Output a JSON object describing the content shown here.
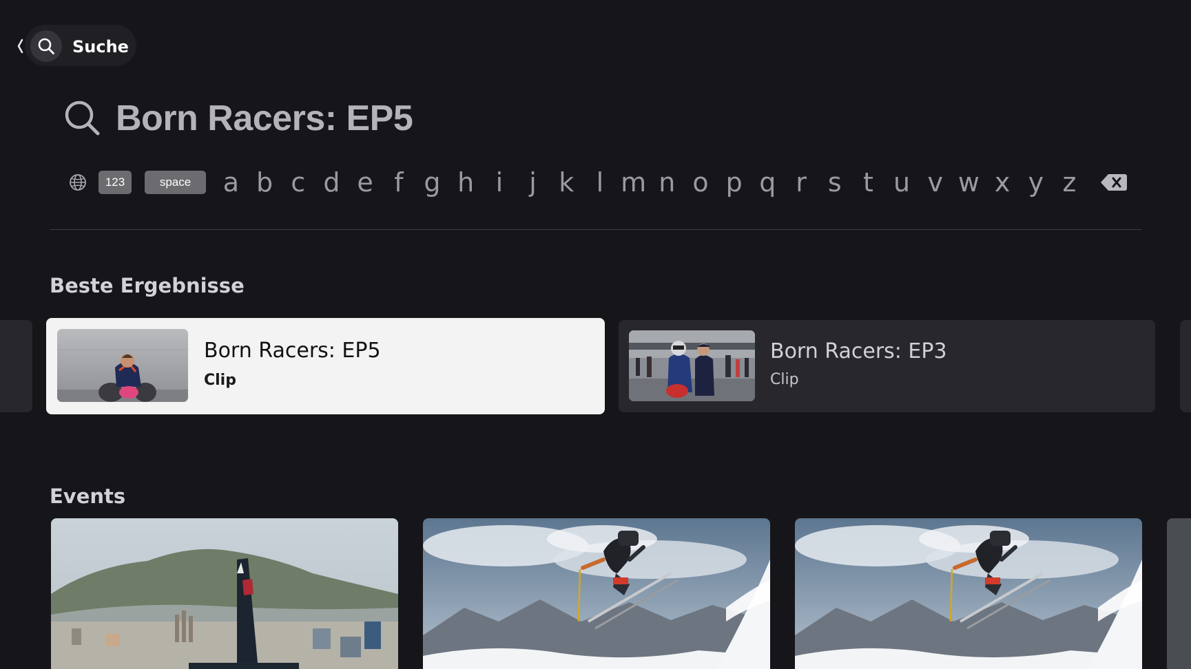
{
  "nav": {
    "back_icon": "chevron-left-icon",
    "search_icon": "search-icon",
    "label": "Suche"
  },
  "search": {
    "icon": "search-icon",
    "query": "Born Racers: EP5"
  },
  "keyboard": {
    "globe_icon": "globe-icon",
    "numbers_key": "123",
    "space_key": "space",
    "letters": [
      "a",
      "b",
      "c",
      "d",
      "e",
      "f",
      "g",
      "h",
      "i",
      "j",
      "k",
      "l",
      "m",
      "n",
      "o",
      "p",
      "q",
      "r",
      "s",
      "t",
      "u",
      "v",
      "w",
      "x",
      "y",
      "z"
    ],
    "delete_icon": "backspace-icon"
  },
  "best_results": {
    "title": "Beste Ergebnisse",
    "items": [
      {
        "title": "Born Racers: EP5",
        "subtitle": "Clip",
        "focused": true,
        "thumbnail": "motorcycle-rider-thumbnail"
      },
      {
        "title": "Born Racers: EP3",
        "subtitle": "Clip",
        "focused": false,
        "thumbnail": "racetrack-grid-thumbnail"
      }
    ]
  },
  "events": {
    "title": "Events",
    "items": [
      {
        "thumbnail": "sailing-boat-barcelona-image"
      },
      {
        "thumbnail": "freeride-skier-image"
      },
      {
        "thumbnail": "freeride-skier-image"
      }
    ]
  },
  "colors": {
    "background": "#16161a",
    "card_focused": "#f3f3f3",
    "card_default": "#27272c",
    "key_pill": "#6b6b70"
  }
}
